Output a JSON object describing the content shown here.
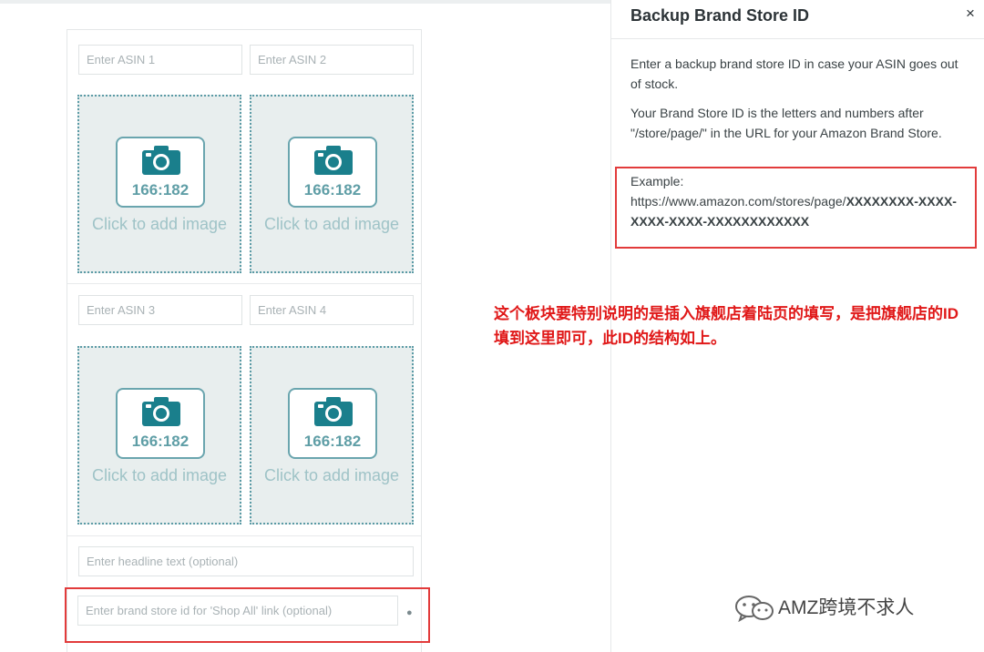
{
  "editor": {
    "asin_placeholders": [
      "Enter ASIN 1",
      "Enter ASIN 2",
      "Enter ASIN 3",
      "Enter ASIN 4"
    ],
    "image_tiles": [
      {
        "ratio": "166:182",
        "label": "Click to add image"
      },
      {
        "ratio": "166:182",
        "label": "Click to add image"
      },
      {
        "ratio": "166:182",
        "label": "Click to add image"
      },
      {
        "ratio": "166:182",
        "label": "Click to add image"
      }
    ],
    "headline_placeholder": "Enter headline text (optional)",
    "brand_store_placeholder": "Enter brand store id for 'Shop All' link (optional)"
  },
  "panel": {
    "title": "Backup Brand Store ID",
    "close_label": "×",
    "description": "Enter a backup brand store ID in case your ASIN goes out of stock.",
    "brand_store_info": "Your Brand Store ID is the letters and numbers after \"/store/page/\" in the URL for your Amazon Brand Store.",
    "example_label": "Example:",
    "example_url_prefix": "https://www.amazon.com/stores/page/",
    "example_url_id": "XXXXXXXX-XXXX-XXXX-XXXX-XXXXXXXXXXXX"
  },
  "annotation": "这个板块要特别说明的是插入旗舰店着陆页的填写，是把旗舰店的ID填到这里即可，此ID的结构如上。",
  "watermark": "AMZ跨境不求人",
  "colors": {
    "accent": "#1a7f8c",
    "highlight_red": "#e23b3b",
    "annotation_red": "#e01818"
  },
  "icons": [
    "camera-icon",
    "close-icon",
    "wechat-icon"
  ]
}
